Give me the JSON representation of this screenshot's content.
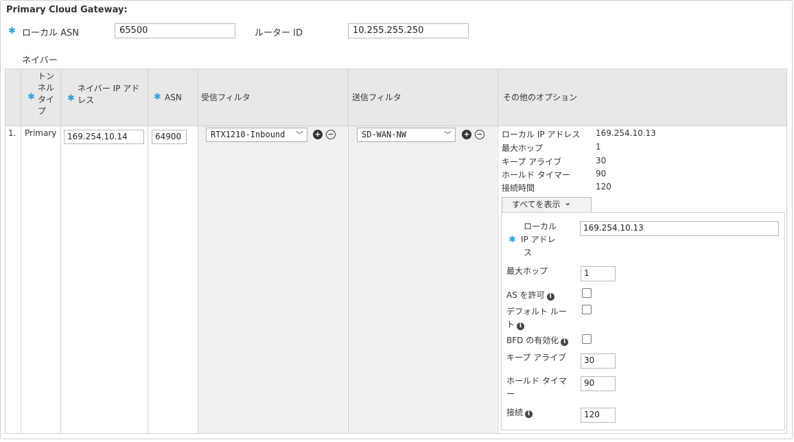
{
  "header": {
    "title": "Primary Cloud Gateway:",
    "local_asn_label": "ローカル ASN",
    "local_asn_value": "65500",
    "router_id_label": "ルーター ID",
    "router_id_value": "10.255.255.250",
    "required_mark": "✱"
  },
  "neighbors": {
    "section_label": "ネイバー",
    "columns": {
      "tunnel_type": [
        "トン",
        "ネル",
        "タイ",
        "プ"
      ],
      "neighbor_ip": [
        "ネイバー IP アド",
        "レス"
      ],
      "asn": "ASN",
      "inbound_filter": "受信フィルタ",
      "outbound_filter": "送信フィルタ",
      "other_options": "その他のオプション"
    },
    "row": {
      "index": "1.",
      "tunnel_type": "Primary",
      "neighbor_ip": "169.254.10.14",
      "asn": "64900",
      "inbound_filter": "RTX1210-Inbound",
      "outbound_filter": "SD-WAN-NW",
      "add_symbol": "+",
      "remove_symbol": "−"
    },
    "options_summary": [
      {
        "label": "ローカル IP アドレス",
        "value": "169.254.10.13"
      },
      {
        "label": "最大ホップ",
        "value": "1"
      },
      {
        "label": "キープ アライブ",
        "value": "30"
      },
      {
        "label": "ホールド タイマー",
        "value": "90"
      },
      {
        "label": "接続時間",
        "value": "120"
      }
    ],
    "show_all_button": "すべてを表示",
    "show_all_chevron": "⌄",
    "panel": {
      "local_ip_label": [
        "ローカル",
        "IP アドレ",
        "ス"
      ],
      "local_ip_value": "169.254.10.13",
      "max_hop_label": "最大ホップ",
      "max_hop_value": "1",
      "allow_as_label": "AS を許可",
      "default_route_label": [
        "デフォルト ルー",
        "ト"
      ],
      "bfd_label": "BFD の有効化",
      "keepalive_label": "キープ アライブ",
      "keepalive_value": "30",
      "hold_timer_label": [
        "ホールド タイマ",
        "ー"
      ],
      "hold_timer_value": "90",
      "connect_label": "接続",
      "connect_value": "120",
      "info_glyph": "i"
    }
  }
}
